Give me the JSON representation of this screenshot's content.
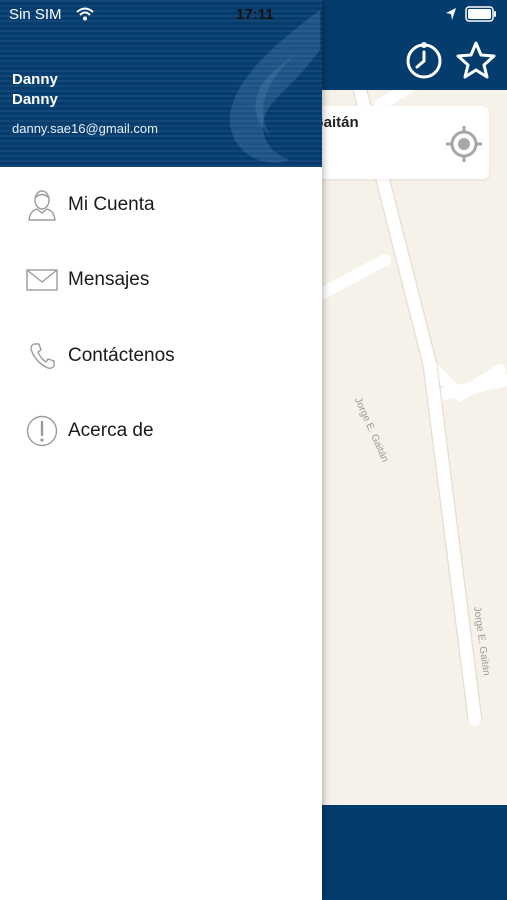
{
  "status_bar": {
    "carrier": "Sin SIM",
    "time": "17:11"
  },
  "user": {
    "first_name": "Danny",
    "last_name": "Danny",
    "email": "danny.sae16@gmail.com"
  },
  "menu": {
    "items": [
      {
        "label": "Mi Cuenta",
        "icon": "user-icon"
      },
      {
        "label": "Mensajes",
        "icon": "envelope-icon"
      },
      {
        "label": "Contáctenos",
        "icon": "phone-icon"
      },
      {
        "label": "Acerca de",
        "icon": "info-icon"
      }
    ]
  },
  "map": {
    "search_text": "Gaitán",
    "street_labels": [
      "Jorge E. Gaitán",
      "Jorge E. Gaitán"
    ]
  },
  "colors": {
    "brand": "#053c6e",
    "map_background": "#f6f1e9",
    "road": "#ffffff"
  }
}
